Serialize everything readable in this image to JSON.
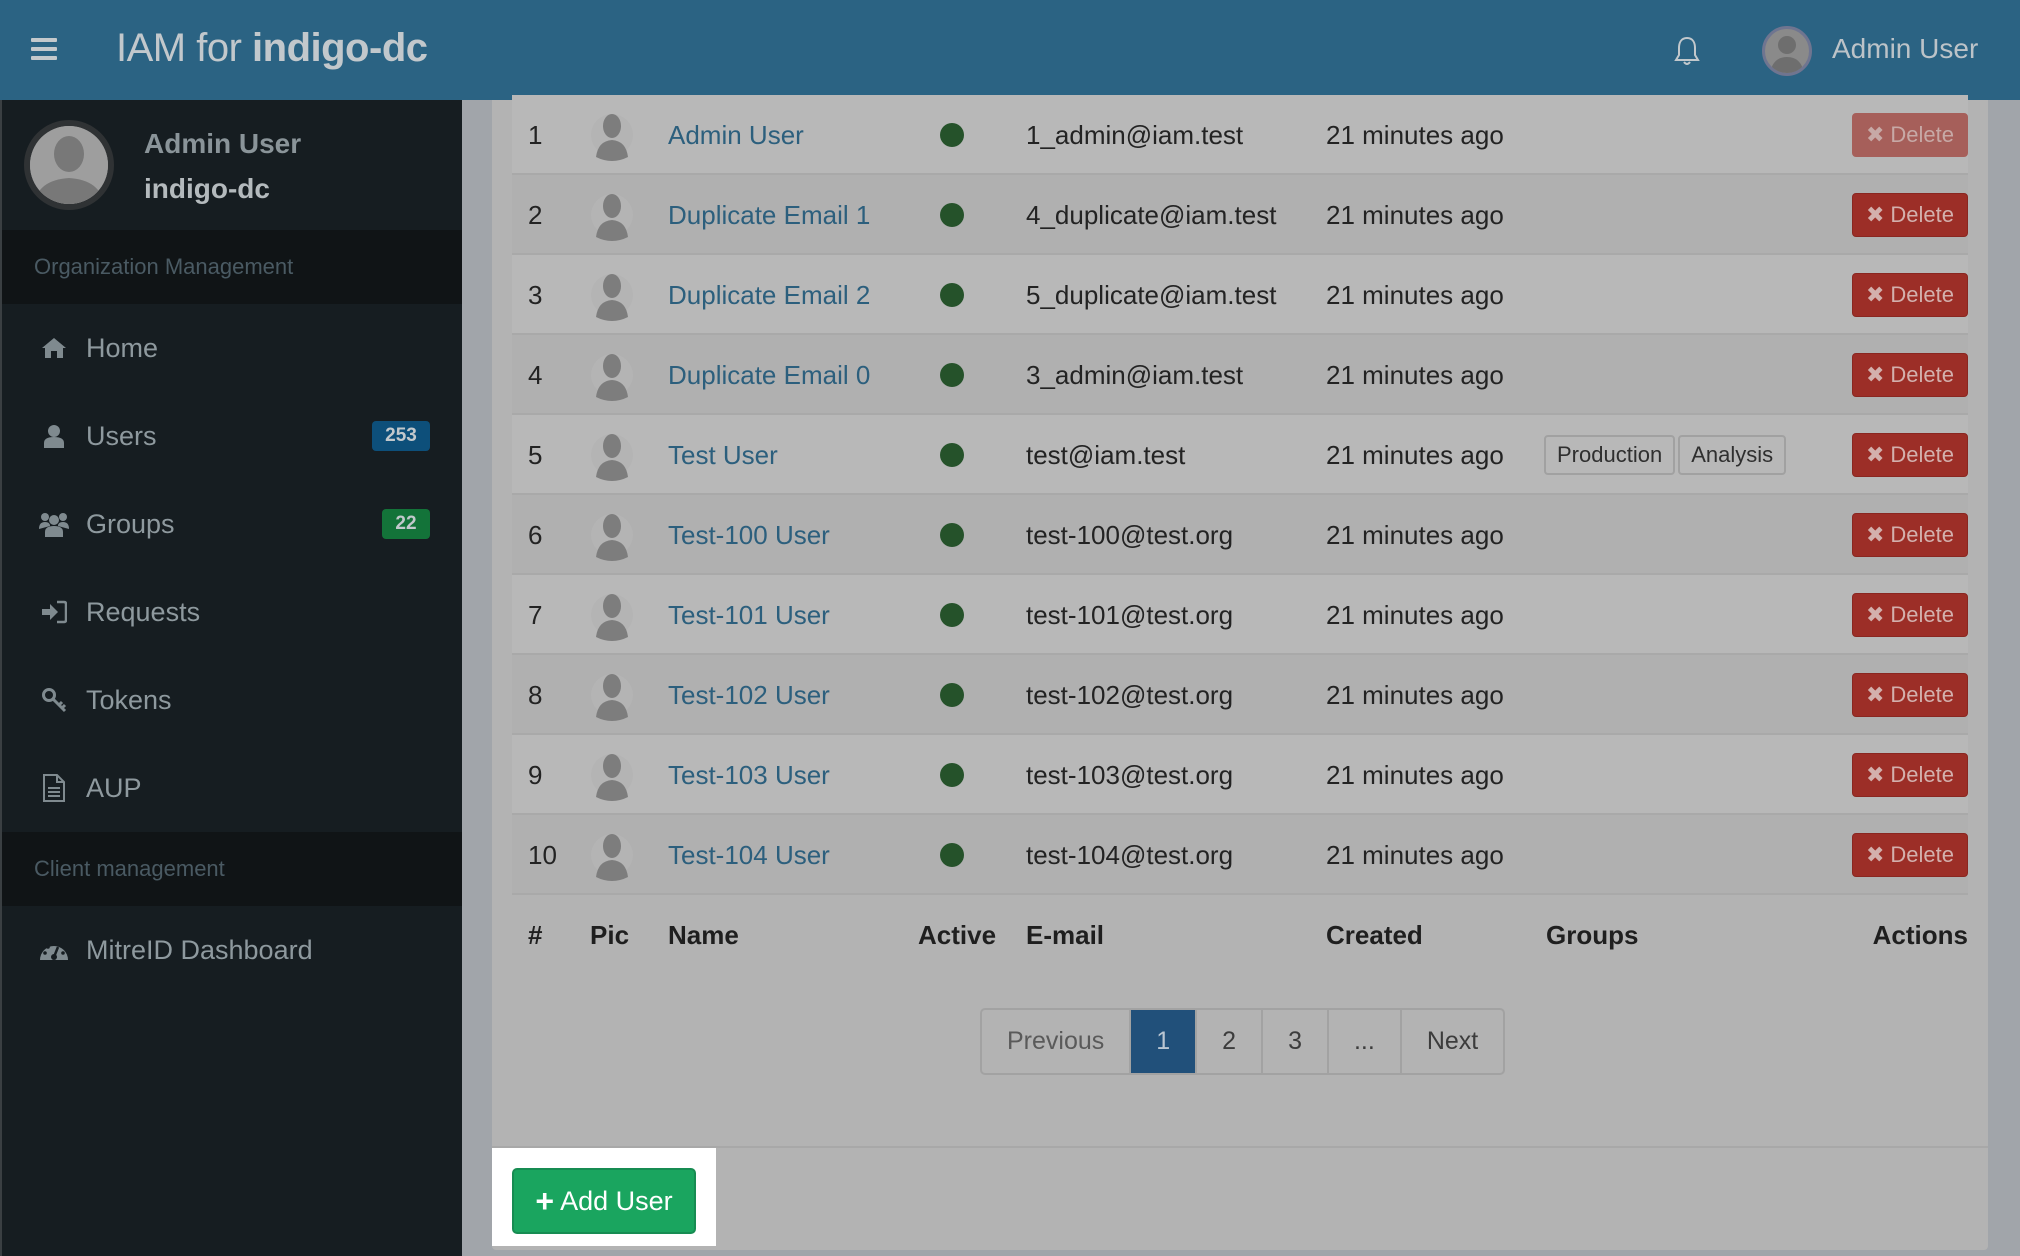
{
  "header": {
    "brand_light": "IAM for ",
    "brand_bold": "indigo-dc",
    "menu_icon": "hamburger-icon",
    "notifications_icon": "bell-icon",
    "user_name": "Admin User"
  },
  "sidebar": {
    "user": {
      "name": "Admin User",
      "organization": "indigo-dc"
    },
    "sections": [
      {
        "title": "Organization Management"
      },
      {
        "title": "Client management"
      }
    ],
    "items": [
      {
        "label": "Home",
        "icon": "home-icon"
      },
      {
        "label": "Users",
        "icon": "user-icon",
        "badge": "253",
        "badge_color": "#0d4f7a"
      },
      {
        "label": "Groups",
        "icon": "users-group-icon",
        "badge": "22",
        "badge_color": "#137339"
      },
      {
        "label": "Requests",
        "icon": "sign-in-icon"
      },
      {
        "label": "Tokens",
        "icon": "key-icon"
      },
      {
        "label": "AUP",
        "icon": "document-icon"
      },
      {
        "label": "MitreID Dashboard",
        "icon": "dashboard-icon"
      }
    ]
  },
  "table": {
    "columns": [
      "#",
      "Pic",
      "Name",
      "Active",
      "E-mail",
      "Created",
      "Groups",
      "Actions"
    ],
    "delete_label": "Delete",
    "rows": [
      {
        "num": "1",
        "name": "Admin User",
        "active": true,
        "email": "1_admin@iam.test",
        "created": "21 minutes ago",
        "groups": [],
        "delete_disabled": true
      },
      {
        "num": "2",
        "name": "Duplicate Email 1",
        "active": true,
        "email": "4_duplicate@iam.test",
        "created": "21 minutes ago",
        "groups": [],
        "delete_disabled": false
      },
      {
        "num": "3",
        "name": "Duplicate Email 2",
        "active": true,
        "email": "5_duplicate@iam.test",
        "created": "21 minutes ago",
        "groups": [],
        "delete_disabled": false
      },
      {
        "num": "4",
        "name": "Duplicate Email 0",
        "active": true,
        "email": "3_admin@iam.test",
        "created": "21 minutes ago",
        "groups": [],
        "delete_disabled": false
      },
      {
        "num": "5",
        "name": "Test User",
        "active": true,
        "email": "test@iam.test",
        "created": "21 minutes ago",
        "groups": [
          "Production",
          "Analysis"
        ],
        "delete_disabled": false
      },
      {
        "num": "6",
        "name": "Test-100 User",
        "active": true,
        "email": "test-100@test.org",
        "created": "21 minutes ago",
        "groups": [],
        "delete_disabled": false
      },
      {
        "num": "7",
        "name": "Test-101 User",
        "active": true,
        "email": "test-101@test.org",
        "created": "21 minutes ago",
        "groups": [],
        "delete_disabled": false
      },
      {
        "num": "8",
        "name": "Test-102 User",
        "active": true,
        "email": "test-102@test.org",
        "created": "21 minutes ago",
        "groups": [],
        "delete_disabled": false
      },
      {
        "num": "9",
        "name": "Test-103 User",
        "active": true,
        "email": "test-103@test.org",
        "created": "21 minutes ago",
        "groups": [],
        "delete_disabled": false
      },
      {
        "num": "10",
        "name": "Test-104 User",
        "active": true,
        "email": "test-104@test.org",
        "created": "21 minutes ago",
        "groups": [],
        "delete_disabled": false
      }
    ]
  },
  "pagination": {
    "previous": "Previous",
    "pages": [
      "1",
      "2",
      "3",
      "..."
    ],
    "current": "1",
    "next": "Next"
  },
  "footer": {
    "add_user_label": "Add User"
  },
  "colors": {
    "header": "#2b6383",
    "sidebar": "#161d21",
    "link": "#2c5f7d",
    "active_dot": "#25522a",
    "delete": "#9c2e27",
    "add_user": "#1aa55f",
    "page_active": "#21507a"
  }
}
